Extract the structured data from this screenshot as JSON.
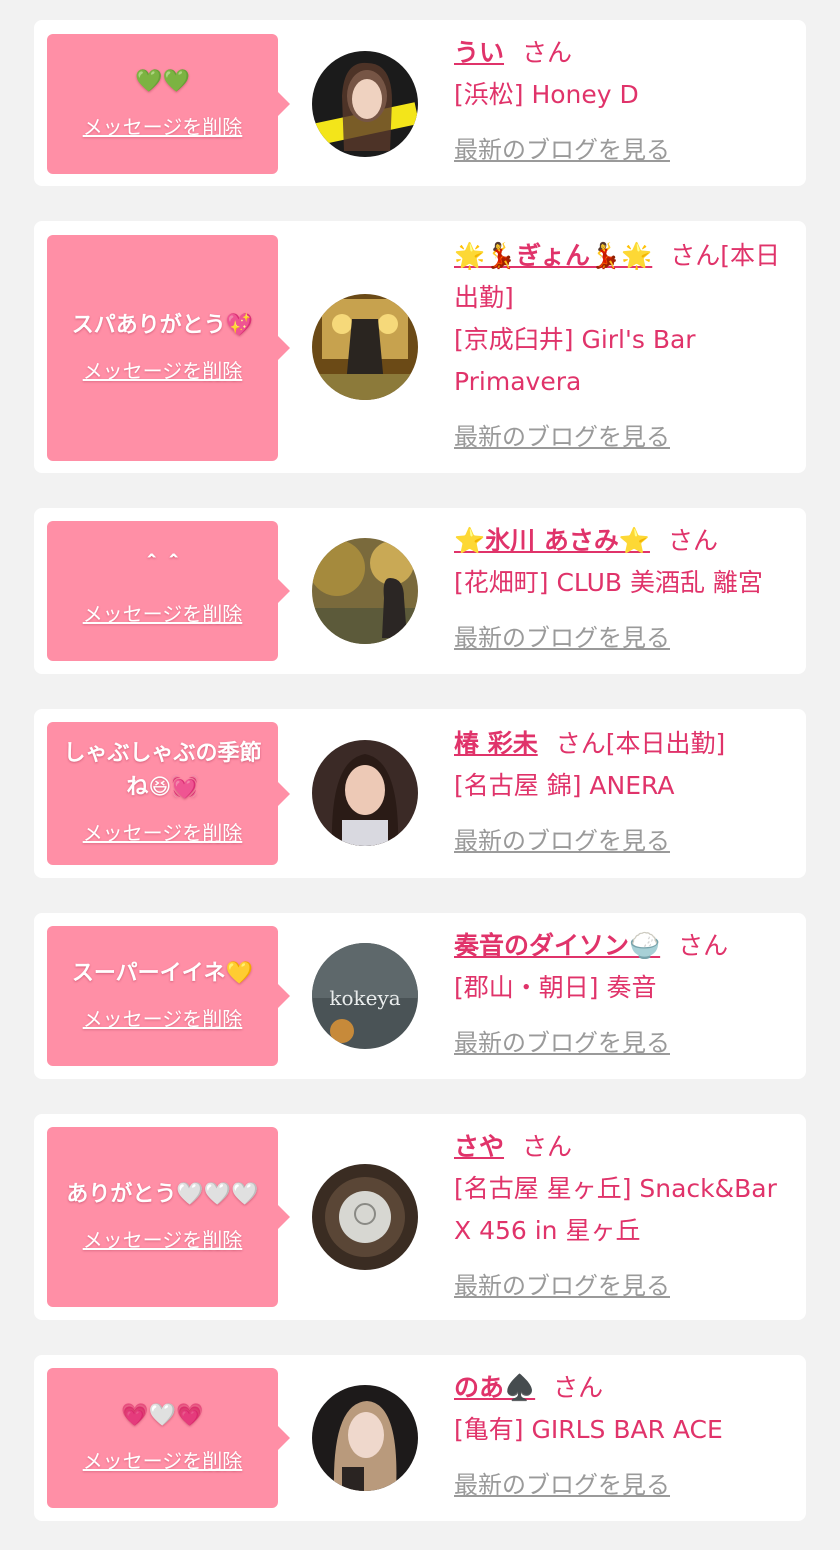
{
  "delete_label": "メッセージを削除",
  "blog_label": "最新のブログを見る",
  "honorific": "さん",
  "colors": {
    "accent": "#e0336a",
    "bubble": "#ff8fa6",
    "link_gray": "#9a9a9a"
  },
  "items": [
    {
      "message": "💚💚",
      "name": "うい",
      "status": "",
      "shop": "[浜松] Honey D"
    },
    {
      "message": "スパありがとう💖",
      "name": "🌟💃ぎょん💃🌟",
      "status": "[本日出勤]",
      "shop": "[京成臼井] Girl's Bar Primavera"
    },
    {
      "message": "＾＾",
      "name": "⭐氷川 あさみ⭐",
      "status": "",
      "shop": "[花畑町] CLUB 美酒乱 離宮"
    },
    {
      "message": "しゃぶしゃぶの季節ね😆💓",
      "name": "椿 彩未",
      "status": "[本日出勤]",
      "shop": "[名古屋 錦] ANERA"
    },
    {
      "message": "スーパーイイネ💛",
      "name": "奏音のダイソン🍚",
      "status": "",
      "shop": "[郡山・朝日] 奏音"
    },
    {
      "message": "ありがとう🤍🤍🤍",
      "name": "さや",
      "status": "",
      "shop": "[名古屋 星ヶ丘] Snack&Bar X 456 in 星ヶ丘"
    },
    {
      "message": "💗🤍💗",
      "name": "のあ♠️",
      "status": "",
      "shop": "[亀有] GIRLS BAR ACE"
    }
  ]
}
